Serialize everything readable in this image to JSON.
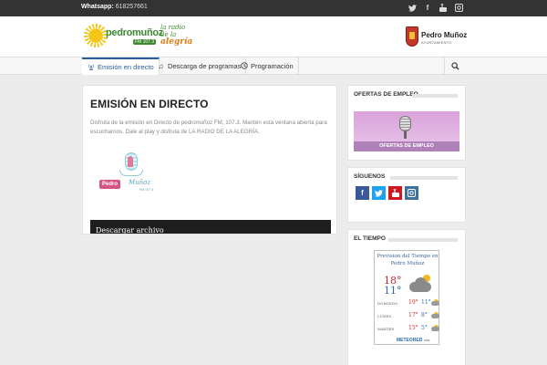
{
  "topbar": {
    "whatsapp_label": "Whatsapp:",
    "whatsapp_number": "618257661",
    "social": [
      "twitter-icon",
      "facebook-icon",
      "youtube-icon",
      "instagram-icon"
    ]
  },
  "header": {
    "logo": {
      "name": "pedromuñoz",
      "fm": "FM 107.3",
      "slogan_line1": "la radio",
      "slogan_line2": "de la",
      "slogan_line3": "alegría"
    },
    "ayuntamiento": {
      "name": "Pedro Muñoz",
      "subtitle": "AYUNTAMIENTO"
    }
  },
  "nav": {
    "items": [
      {
        "label": "Emisión en directo",
        "icon": "antenna-icon",
        "active": true
      },
      {
        "label": "Descarga de programas",
        "icon": "music-note-icon",
        "active": false
      },
      {
        "label": "Programación",
        "icon": "clock-icon",
        "active": false
      }
    ]
  },
  "main": {
    "title": "EMISIÓN EN DIRECTO",
    "description": "Disfruta de la emisión en Directo de pedromuñoz FM, 107.3. Mantén esta ventana abierta para escucharnos. Dale al play y disfruta de LA RADIO DE LA ALEGRÍA.",
    "thumb": {
      "label1": "Pedro",
      "label2": "Muñoz",
      "label3": "FM 107.3"
    },
    "download_label": "Descargar archivo"
  },
  "sidebar": {
    "jobs": {
      "title": "OFERTAS DE EMPLEO",
      "banner_label": "OFERTAS DE EMPLEO"
    },
    "follow": {
      "title": "SÍGUENOS",
      "buttons": [
        {
          "icon": "facebook-icon",
          "glyph": "f",
          "color": "#3b5998"
        },
        {
          "icon": "twitter-icon",
          "glyph": "t",
          "color": "#1da1f2"
        },
        {
          "icon": "youtube-icon",
          "glyph": "▶",
          "color": "#cc181e"
        },
        {
          "icon": "instagram-icon",
          "glyph": "◎",
          "color": "#3f729b"
        }
      ]
    },
    "weather": {
      "title": "EL TIEMPO",
      "widget_title": "Prevision del Tiempo en Pedro Muñoz",
      "today_max": "18°",
      "today_min": "11°",
      "forecast": [
        {
          "day": "DOMINGO",
          "max": "19°",
          "min": "11°"
        },
        {
          "day": "LUNES",
          "max": "17°",
          "min": "8°"
        },
        {
          "day": "MARTES",
          "max": "15°",
          "min": "5°"
        }
      ],
      "provider": "METEORED",
      "provider_suffix": "más"
    }
  }
}
